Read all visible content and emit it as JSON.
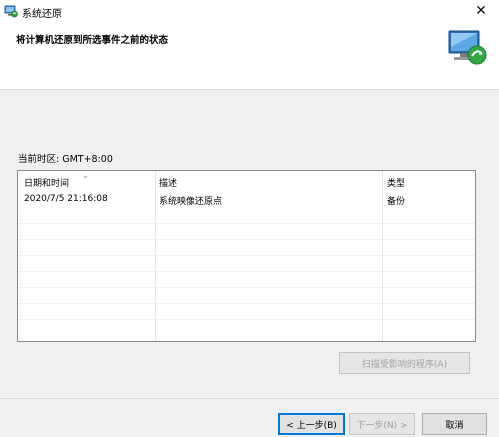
{
  "window": {
    "title": "系统还原"
  },
  "header": {
    "heading": "将计算机还原到所选事件之前的状态"
  },
  "timezone_label": "当前时区: GMT+8:00",
  "table": {
    "columns": [
      "日期和时间",
      "描述",
      "类型"
    ],
    "rows": [
      {
        "datetime": "2020/7/5 21:16:08",
        "description": "系统映像还原点",
        "type": "备份"
      }
    ]
  },
  "buttons": {
    "scan": "扫描受影响的程序(A)",
    "back": "< 上一步(B)",
    "next": "下一步(N) >",
    "cancel": "取消"
  },
  "icons": {
    "app": "system-restore-icon",
    "header": "computer-restore-icon",
    "close": "close-icon",
    "sort": "sort-descending-icon"
  },
  "colors": {
    "focus_border": "#0078d7",
    "disabled_text": "#a0a0a0"
  }
}
